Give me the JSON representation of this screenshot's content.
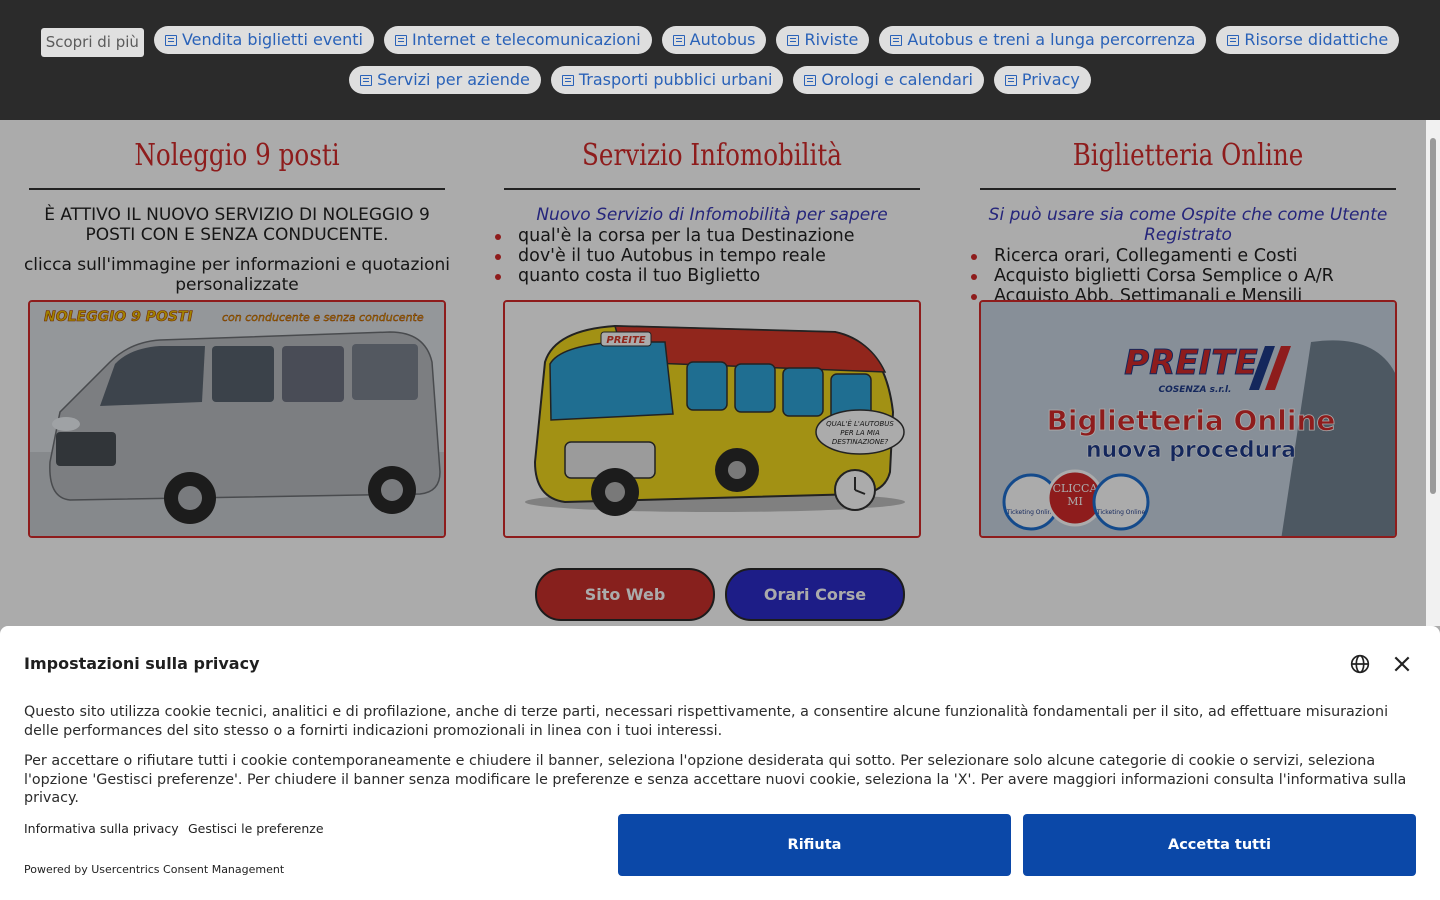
{
  "discover": {
    "label": "Scopri di più",
    "chips": [
      "Vendita biglietti eventi",
      "Internet e telecomunicazioni",
      "Autobus",
      "Riviste",
      "Autobus e treni a lunga percorrenza",
      "Risorse didattiche",
      "Servizi per aziende",
      "Trasporti pubblici urbani",
      "Orologi e calendari",
      "Privacy"
    ],
    "chip_icon": "news-icon"
  },
  "columns": {
    "noleggio": {
      "title": "Noleggio 9 posti",
      "text1": "È ATTIVO IL NUOVO SERVIZIO DI NOLEGGIO 9 POSTI CON E SENZA CONDUCENTE.",
      "text2": "clicca sull'immagine per informazioni e quotazioni personalizzate",
      "banner_title": "NOLEGGIO 9 POSTI",
      "banner_sub": "con conducente e senza conducente"
    },
    "infomobilita": {
      "title": "Servizio Infomobilità",
      "lead": "Nuovo Servizio di Infomobilità per sapere",
      "bullets": [
        "qual'è la corsa per la tua Destinazione",
        "dov'è il tuo Autobus in tempo reale",
        "quanto costa il tuo Biglietto"
      ],
      "bus_logo": "PREITE",
      "bubble_lines": [
        "QUAL'È L'AUTOBUS",
        "PER LA MIA",
        "DESTINAZIONE?"
      ]
    },
    "biglietteria": {
      "title": "Biglietteria Online",
      "lead": "Si può usare sia come Ospite che come Utente Registrato",
      "bullets": [
        "Ricerca orari, Collegamenti e Costi",
        "Acquisto biglietti Corsa Semplice o A/R",
        "Acquisto Abb. Settimanali e Mensili"
      ],
      "logo": "PREITE",
      "logo_sub": "COSENZA s.r.l.",
      "banner_line1": "Biglietteria Online",
      "banner_line2": "nuova procedura",
      "badge_text": "Ticketing Online",
      "click_text1": "CLICCA",
      "click_text2": "MI"
    }
  },
  "buttons": {
    "sito_web": "Sito Web",
    "orari_corse": "Orari Corse"
  },
  "consent": {
    "title": "Impostazioni sulla privacy",
    "paragraph1": "Questo sito utilizza cookie tecnici, analitici e di profilazione, anche di terze parti, necessari rispettivamente, a consentire alcune funzionalità fondamentali per il sito, ad effettuare misurazioni delle performances del sito stesso o a fornirti indicazioni promozionali in linea con i tuoi interessi.",
    "paragraph2": "Per accettare o rifiutare tutti i cookie contemporaneamente e chiudere il banner, seleziona l'opzione desiderata qui sotto. Per selezionare solo alcune categorie di cookie o servizi, seleziona l'opzione 'Gestisci preferenze'. Per chiudere il banner senza modificare le preferenze e senza accettare nuovi cookie, seleziona la 'X'. Per avere maggiori informazioni consulta l'informativa sulla privacy.",
    "link_privacy": "Informativa sulla privacy",
    "link_prefs": "Gestisci le preferenze",
    "powered": "Powered by Usercentrics Consent Management",
    "reject": "Rifiuta",
    "accept": "Accetta tutti"
  },
  "colors": {
    "accent_red": "#d42a2a",
    "accent_blue": "#3838b8",
    "consent_button": "#0b48a8",
    "topbar": "#2b2b2b",
    "chip_text": "#2a62b8"
  }
}
